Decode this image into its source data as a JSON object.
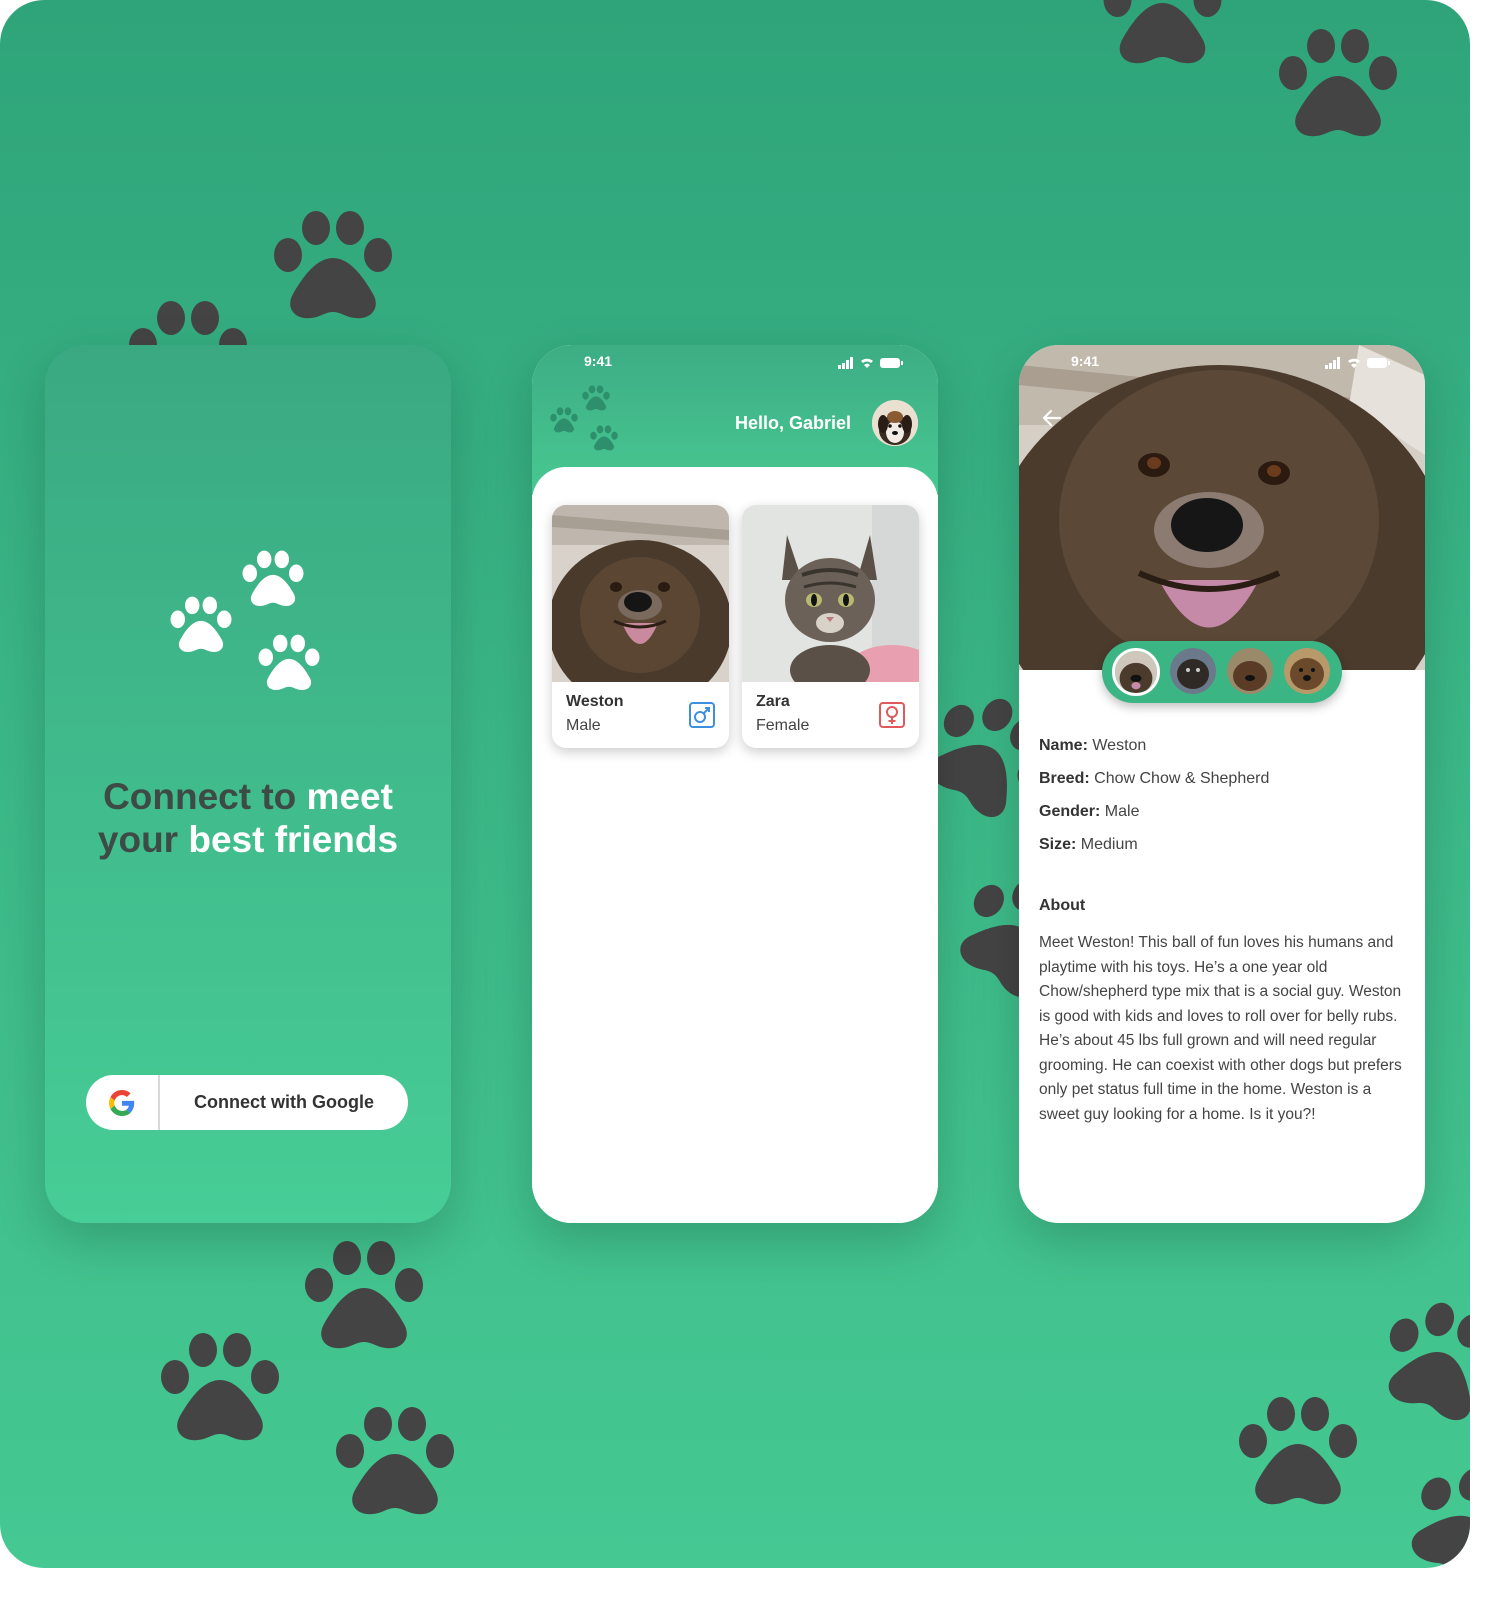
{
  "screen1": {
    "title_part1": "Connect to ",
    "title_part2": "meet",
    "title_part3": "your ",
    "title_part4": "best friends",
    "google_button_label": "Connect with Google"
  },
  "screen2": {
    "status_time": "9:41",
    "greeting": "Hello, Gabriel",
    "pets": [
      {
        "name": "Weston",
        "gender": "Male",
        "gender_icon": "male-icon"
      },
      {
        "name": "Zara",
        "gender": "Female",
        "gender_icon": "female-icon"
      }
    ]
  },
  "screen3": {
    "status_time": "9:41",
    "details": [
      {
        "label": "Name:",
        "value": "Weston"
      },
      {
        "label": "Breed:",
        "value": "Chow Chow & Shepherd"
      },
      {
        "label": "Gender:",
        "value": "Male"
      },
      {
        "label": "Size:",
        "value": "Medium"
      }
    ],
    "about_heading": "About",
    "about_text": "Meet Weston! This ball of fun loves his humans and playtime with his toys. He’s a one year old Chow/shepherd type mix that is a social guy. Weston is good with kids and loves to roll over for belly rubs. He’s about 45 lbs full grown and will need regular grooming. He can coexist with other dogs but prefers only pet status full time in the home. Weston is a sweet guy looking for a home. Is it you?!"
  },
  "colors": {
    "brand_green": "#45c892",
    "paw_dark": "#444444",
    "male_blue": "#3d8fe0",
    "female_red": "#e05a5a"
  }
}
